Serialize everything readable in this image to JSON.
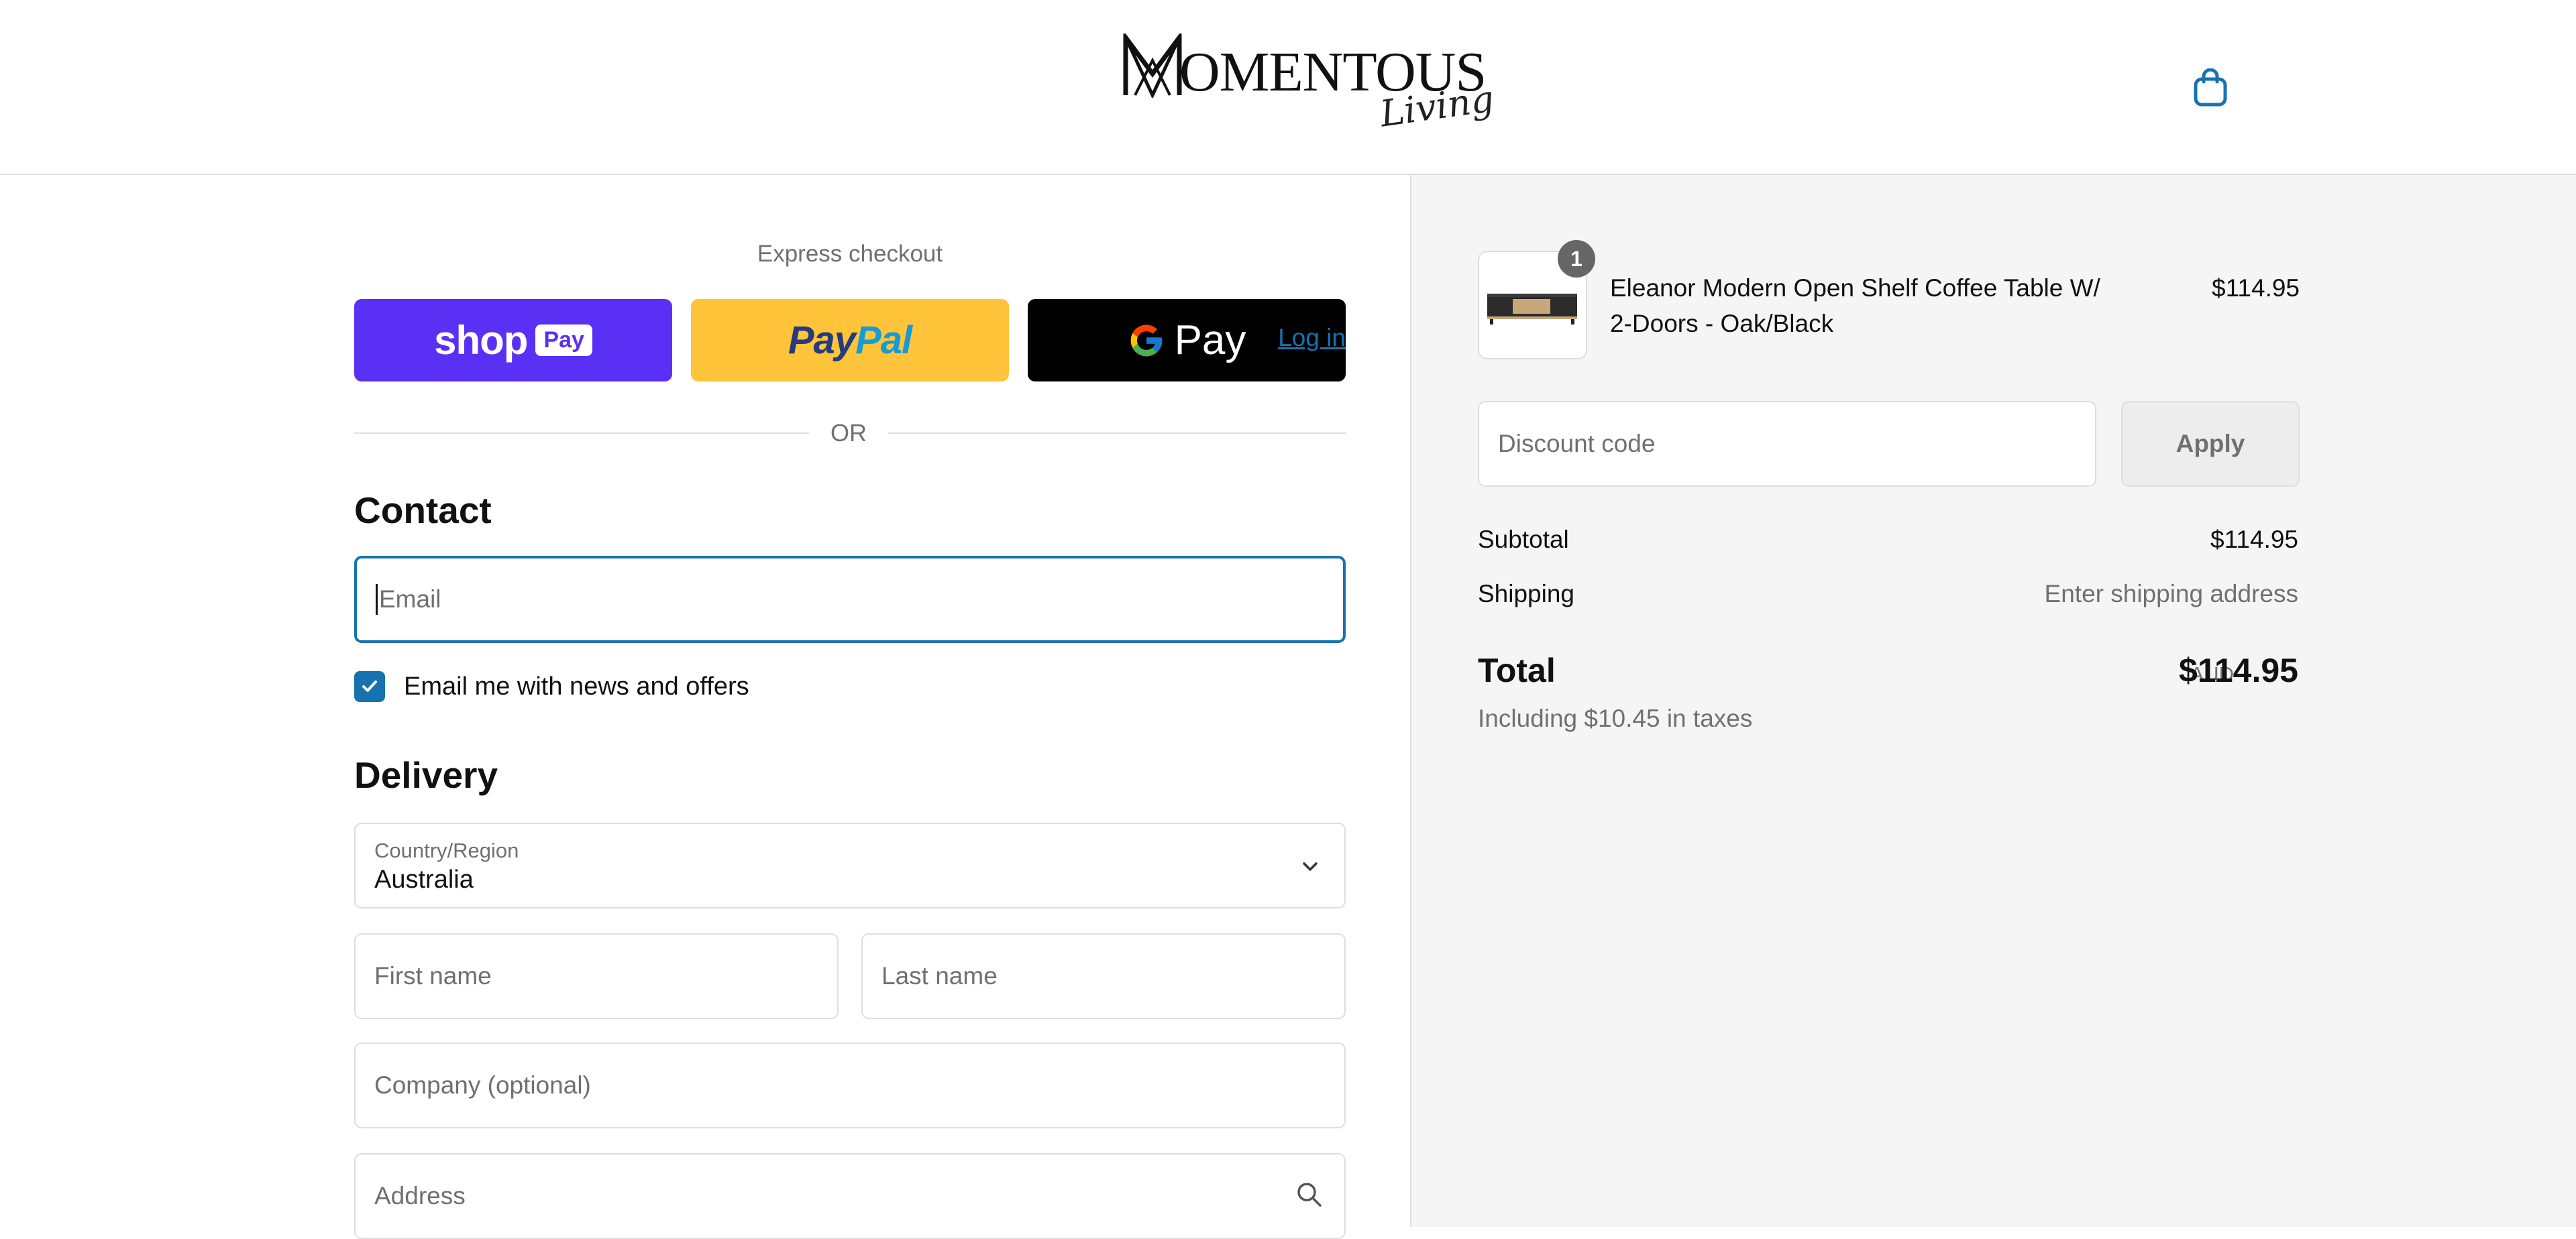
{
  "header": {
    "brand_main": "OMENTOUS",
    "brand_sub": "Living",
    "cart_icon": "shopping-bag-icon"
  },
  "express": {
    "title": "Express checkout",
    "shop_pay": {
      "word": "shop",
      "pill": "Pay"
    },
    "paypal": {
      "part1": "Pay",
      "part2": "Pal"
    },
    "gpay": {
      "word": "Pay"
    },
    "or_text": "OR"
  },
  "contact": {
    "title": "Contact",
    "login": "Log in",
    "email_placeholder": "Email",
    "newsletter_label": "Email me with news and offers",
    "newsletter_checked": true
  },
  "delivery": {
    "title": "Delivery",
    "country_label": "Country/Region",
    "country_value": "Australia",
    "first_name_placeholder": "First name",
    "last_name_placeholder": "Last name",
    "company_placeholder": "Company (optional)",
    "address_placeholder": "Address"
  },
  "summary": {
    "item": {
      "quantity": "1",
      "title": "Eleanor Modern Open Shelf Coffee Table W/ 2-Doors - Oak/Black",
      "price": "$114.95"
    },
    "discount_placeholder": "Discount code",
    "apply_label": "Apply",
    "subtotal_label": "Subtotal",
    "subtotal_value": "$114.95",
    "shipping_label": "Shipping",
    "shipping_value": "Enter shipping address",
    "total_label": "Total",
    "currency": "AUD",
    "total_value": "$114.95",
    "taxes_note": "Including $10.45 in taxes"
  },
  "colors": {
    "accent": "#1773b0",
    "shop_pay": "#5a31f4",
    "paypal": "#ffc439",
    "gpay": "#000000",
    "summary_bg": "#f5f5f5"
  }
}
